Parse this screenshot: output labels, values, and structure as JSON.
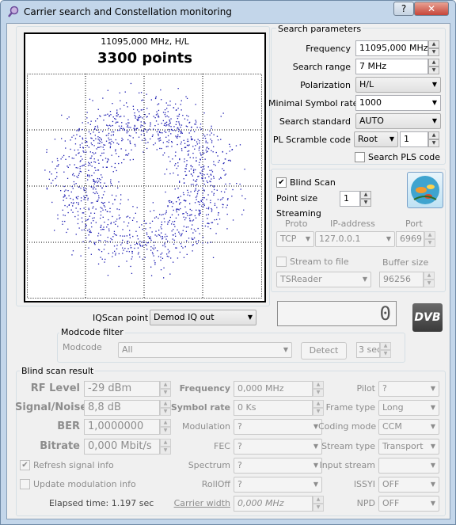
{
  "window": {
    "title": "Carrier search and Constellation monitoring",
    "help_label": "?",
    "close_label": "✕"
  },
  "constellation": {
    "freq_label": "11095,000 MHz, H/L",
    "points_label": "3300 points",
    "dot_color": "#1a1ab0",
    "icon": "scatter-plot"
  },
  "search": {
    "group_title": "Search parameters",
    "frequency_label": "Frequency",
    "frequency_value": "11095,000 MHz",
    "range_label": "Search range",
    "range_value": "7 MHz",
    "polarization_label": "Polarization",
    "polarization_value": "H/L",
    "symbol_rate_label": "Minimal Symbol rate",
    "symbol_rate_value": "1000",
    "standard_label": "Search standard",
    "standard_value": "AUTO",
    "pls_label": "PL Scramble code",
    "pls_mode": "Root",
    "pls_value": "1",
    "search_pls_label": "Search PLS code"
  },
  "blind": {
    "blind_scan_label": "Blind Scan",
    "blind_scan_checked": "✔",
    "point_size_label": "Point size",
    "point_size_value": "1"
  },
  "streaming": {
    "title": "Streaming",
    "proto_label": "Proto",
    "ip_label": "IP-address",
    "port_label": "Port",
    "proto_value": "TCP",
    "ip_value": "127.0.0.1",
    "port_value": "6969",
    "stream_to_file_label": "Stream to file",
    "buffer_label": "Buffer size",
    "file_format_value": "TSReader",
    "buffer_value": "96256"
  },
  "lcd_value": "0",
  "dvb_logo": "DVB",
  "iqscan": {
    "label": "IQScan point",
    "value": "Demod IQ out"
  },
  "modcode": {
    "group_title": "Modcode filter",
    "label": "Modcode",
    "value": "All",
    "detect_label": "Detect",
    "interval_value": "3 sec"
  },
  "result": {
    "group_title": "Blind scan result",
    "rf_label": "RF Level",
    "rf_value": "-29 dBm",
    "snr_label": "Signal/Noise",
    "snr_value": "8,8 dB",
    "ber_label": "BER",
    "ber_value": "1,0000000",
    "bitrate_label": "Bitrate",
    "bitrate_value": "0,000 Mbit/s",
    "frequency_label": "Frequency",
    "frequency_value": "0,000 MHz",
    "symrate_label": "Symbol rate",
    "symrate_value": "0 Ks",
    "modulation_label": "Modulation",
    "modulation_value": "?",
    "fec_label": "FEC",
    "fec_value": "?",
    "spectrum_label": "Spectrum",
    "spectrum_value": "?",
    "rolloff_label": "RollOff",
    "rolloff_value": "?",
    "carrier_width_label": "Carrier width",
    "carrier_width_value": "0,000 MHz",
    "pilot_label": "Pilot",
    "pilot_value": "?",
    "frame_label": "Frame type",
    "frame_value": "Long",
    "coding_label": "Coding mode",
    "coding_value": "CCM",
    "stream_type_label": "Stream type",
    "stream_type_value": "Transport",
    "input_stream_label": "Input stream",
    "input_stream_value": "",
    "issyi_label": "ISSYI",
    "issyi_value": "OFF",
    "npd_label": "NPD",
    "npd_value": "OFF",
    "refresh_label": "Refresh signal info",
    "refresh_checked": "✔",
    "update_label": "Update modulation info",
    "elapsed_label": "Elapsed time: 1.197 sec"
  }
}
